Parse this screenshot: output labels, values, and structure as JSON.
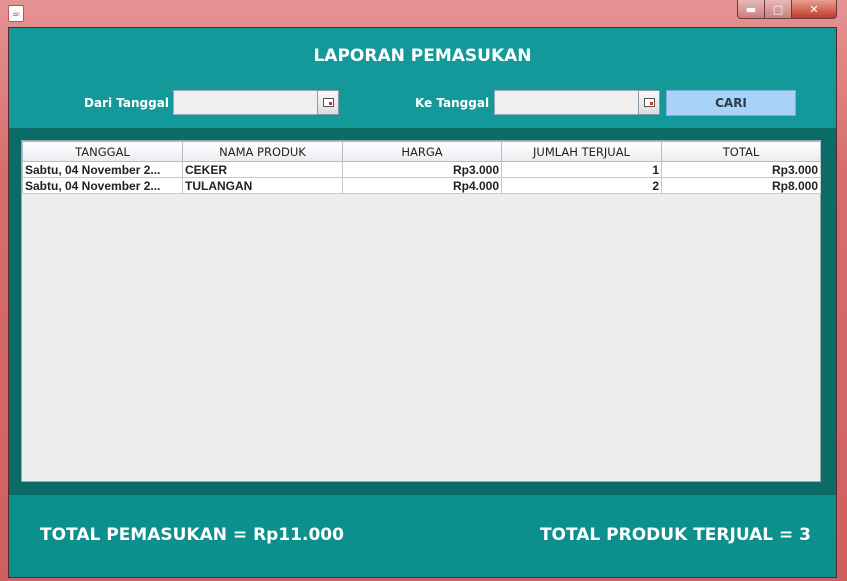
{
  "window": {
    "icon": "java-app-icon"
  },
  "header": {
    "title": "LAPORAN PEMASUKAN",
    "from_label": "Dari Tanggal",
    "to_label": "Ke Tanggal",
    "from_value": "",
    "to_value": "",
    "search_label": "CARI"
  },
  "table": {
    "columns": [
      "TANGGAL",
      "NAMA PRODUK",
      "HARGA",
      "JUMLAH TERJUAL",
      "TOTAL"
    ],
    "rows": [
      [
        "Sabtu, 04 November 2...",
        "CEKER",
        "Rp3.000",
        "1",
        "Rp3.000"
      ],
      [
        "Sabtu, 04 November 2...",
        "TULANGAN",
        "Rp4.000",
        "2",
        "Rp8.000"
      ]
    ]
  },
  "footer": {
    "total_income": "TOTAL PEMASUKAN = Rp11.000",
    "total_sold": "TOTAL PRODUK TERJUAL = 3"
  },
  "colors": {
    "panel": "#13999a",
    "table_bg": "#0a6b67",
    "button": "#a8d2f8"
  }
}
